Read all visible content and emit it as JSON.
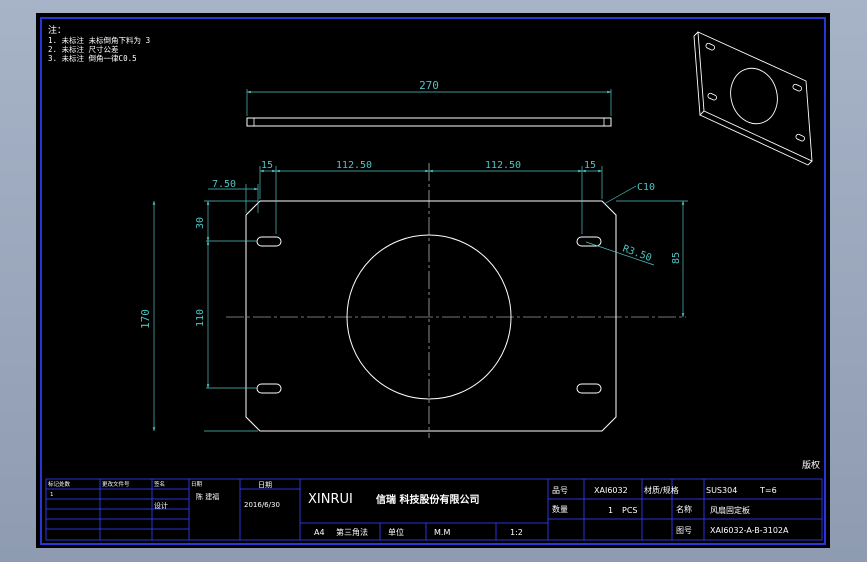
{
  "colors": {
    "background": "#000000",
    "frame": "#2a35d9",
    "outline": "#ffffff",
    "dimension": "#4fc4c4",
    "centerline": "#e8e8e8"
  },
  "notes": {
    "title": "注：",
    "lines": [
      "1. 未标注 未标倒角下料为 3",
      "2. 未标注 尺寸公差",
      "3. 未标注 倒角一律C0.5"
    ]
  },
  "dimensions": {
    "side_length": "270",
    "top_left_offset": "15",
    "top_left_half": "112.50",
    "top_right_half": "112.50",
    "top_right_offset": "15",
    "slot_edge": "7.50",
    "chamfer": "C10",
    "left_first": "30",
    "left_height": "170",
    "left_pitch": "110",
    "slot_radius": "R3.50",
    "right_height": "85"
  },
  "stamp": {
    "text": "版权"
  },
  "title_block": {
    "revision_grid": [
      [
        "标记处数",
        "更改文件号",
        "签名",
        "日期"
      ],
      [
        "1",
        "",
        "",
        ""
      ],
      [
        "",
        "",
        "",
        ""
      ],
      [
        "",
        "",
        "",
        ""
      ],
      [
        "",
        "",
        "",
        ""
      ]
    ],
    "designer_label": "设计",
    "designer_name": "陈 建福",
    "date_label": "日期",
    "date": "2016/6/30",
    "company_en": "XINRUI",
    "company_cn": "信瑞 科技股份有限公司",
    "paper_size": "A4",
    "angle_label": "第三角法",
    "unit_label": "单位",
    "unit": "M.M",
    "scale": "1:2",
    "part_no_label": "品号",
    "part_no": "XAI6032",
    "material_label": "材质/规格",
    "material": "SUS304",
    "thickness": "T=6",
    "qty_label": "数量",
    "qty": "1",
    "qty_unit": "PCS",
    "name_label": "名称",
    "name": "风扇固定板",
    "drawing_no_label": "图号",
    "drawing_no": "XAI6032-A-B-3102A"
  }
}
